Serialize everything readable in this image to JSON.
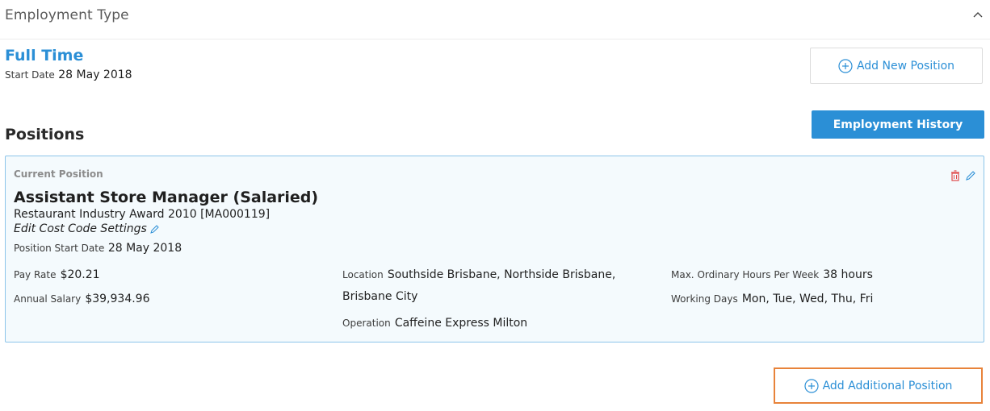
{
  "section": {
    "title": "Employment Type"
  },
  "employment": {
    "type": "Full Time",
    "start_label": "Start Date",
    "start_value": "28 May 2018",
    "add_new_position": "Add New Position"
  },
  "positions": {
    "title": "Positions",
    "history_button": "Employment History",
    "current": {
      "tag": "Current Position",
      "role": "Assistant Store Manager (Salaried)",
      "award": "Restaurant Industry Award 2010 [MA000119]",
      "edit_cost_code": "Edit Cost Code Settings",
      "position_start_label": "Position Start Date",
      "position_start_value": "28 May 2018",
      "pay_rate_label": "Pay Rate",
      "pay_rate_value": "$20.21",
      "annual_salary_label": "Annual Salary",
      "annual_salary_value": "$39,934.96",
      "location_label": "Location",
      "location_value_line1": "Southside Brisbane, Northside Brisbane,",
      "location_value_line2": "Brisbane City",
      "operation_label": "Operation",
      "operation_value": "Caffeine Express Milton",
      "max_hours_label": "Max. Ordinary Hours Per Week",
      "max_hours_value": "38 hours",
      "working_days_label": "Working Days",
      "working_days_value": "Mon, Tue, Wed, Thu, Fri"
    },
    "add_additional": "Add Additional Position"
  },
  "colors": {
    "accent": "#2b8fd6",
    "delete": "#e04a4a",
    "highlight_border": "#e8833a",
    "card_border": "#8cc4ea"
  },
  "icons": [
    "chevron-up-icon",
    "plus-circle-icon",
    "trash-icon",
    "pencil-icon"
  ]
}
